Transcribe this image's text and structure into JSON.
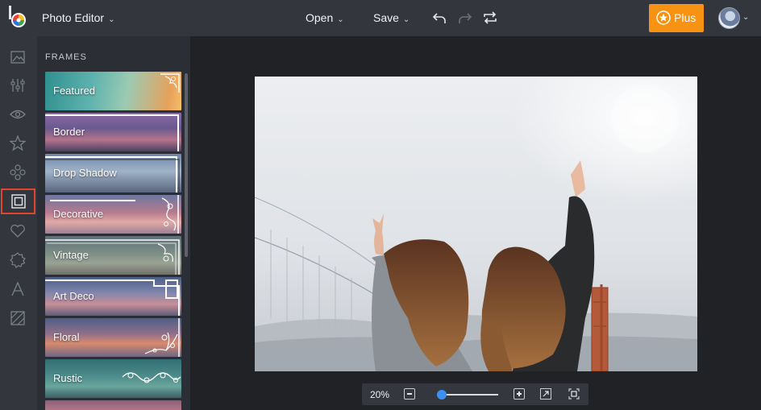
{
  "header": {
    "app_title": "Photo Editor",
    "menus": {
      "open": "Open",
      "save": "Save"
    },
    "plus_label": "Plus",
    "accent_color": "#f89212"
  },
  "sidebar": {
    "tools": [
      {
        "icon": "image-icon",
        "active": false
      },
      {
        "icon": "adjust-sliders-icon",
        "active": false
      },
      {
        "icon": "eye-icon",
        "active": false
      },
      {
        "icon": "star-icon",
        "active": false
      },
      {
        "icon": "circles-icon",
        "active": false
      },
      {
        "icon": "frame-icon",
        "active": true
      },
      {
        "icon": "heart-icon",
        "active": false
      },
      {
        "icon": "gear-badge-icon",
        "active": false
      },
      {
        "icon": "text-icon",
        "active": false
      },
      {
        "icon": "texture-icon",
        "active": false
      }
    ],
    "active_color": "#e0442d"
  },
  "panel": {
    "heading": "FRAMES",
    "items": [
      {
        "label": "Featured"
      },
      {
        "label": "Border"
      },
      {
        "label": "Drop Shadow"
      },
      {
        "label": "Decorative"
      },
      {
        "label": "Vintage"
      },
      {
        "label": "Art Deco"
      },
      {
        "label": "Floral"
      },
      {
        "label": "Rustic"
      }
    ]
  },
  "zoom": {
    "value": "20%",
    "slider_fraction": 0.08,
    "slider_color": "#3d8ff0"
  }
}
